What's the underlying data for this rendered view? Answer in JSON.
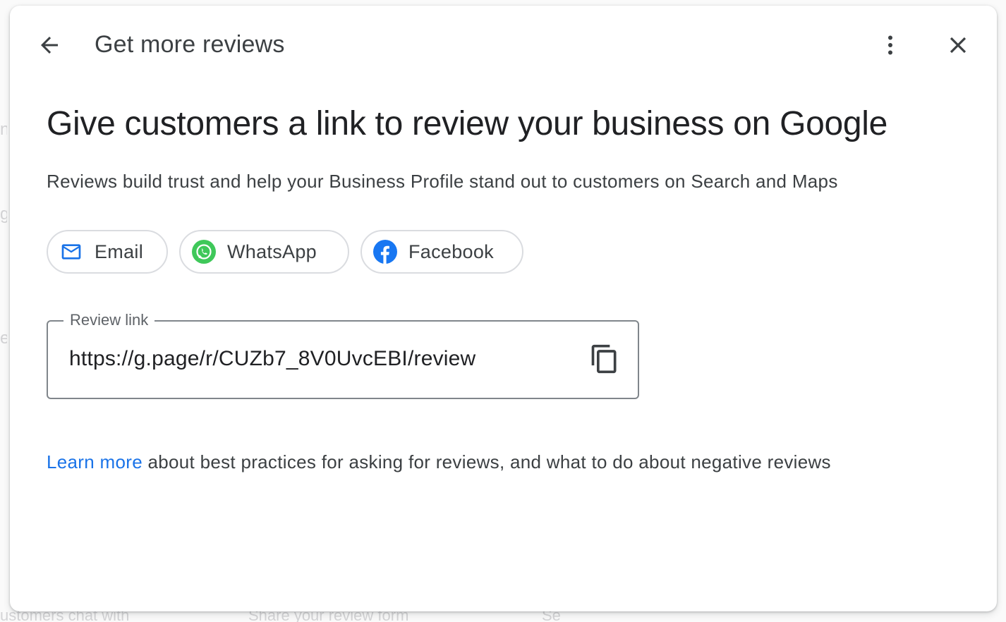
{
  "background": {
    "bottom_texts": [
      "ustomers chat with",
      "Share your review form",
      "Se"
    ]
  },
  "header": {
    "title": "Get more reviews",
    "back_icon": "arrow-back-icon",
    "more_icon": "more-vert-icon",
    "close_icon": "close-icon"
  },
  "content": {
    "headline": "Give customers a link to review your business on Google",
    "subtext": "Reviews build trust and help your Business Profile stand out to customers on Search and Maps"
  },
  "share_options": [
    {
      "label": "Email",
      "icon": "mail-icon"
    },
    {
      "label": "WhatsApp",
      "icon": "whatsapp-icon"
    },
    {
      "label": "Facebook",
      "icon": "facebook-icon"
    }
  ],
  "review_link": {
    "label": "Review link",
    "value": "https://g.page/r/CUZb7_8V0UvcEBI/review",
    "copy_icon": "copy-icon"
  },
  "footer": {
    "link_text": "Learn more",
    "rest_text": " about best practices for asking for reviews, and what to do about negative reviews"
  },
  "colors": {
    "link": "#1a73e8",
    "email_icon": "#1a73e8",
    "whatsapp_green": "#3fc85a",
    "facebook_blue": "#1877f2"
  }
}
